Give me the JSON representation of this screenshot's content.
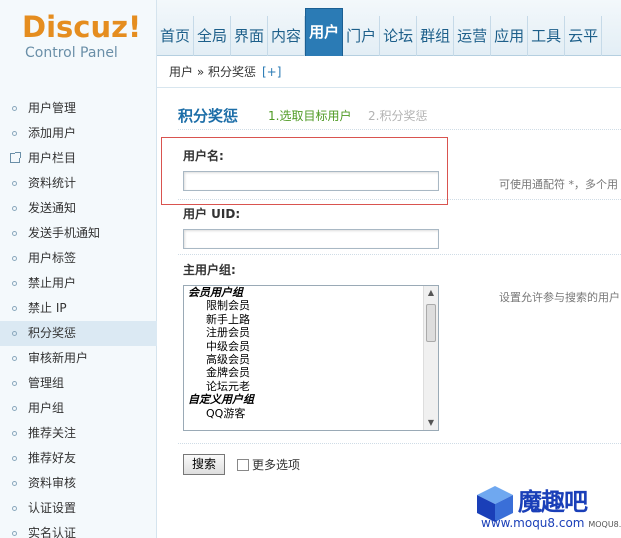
{
  "logo": {
    "main": "Discuz!",
    "sub": "Control Panel"
  },
  "topnav": [
    "首页",
    "全局",
    "界面",
    "内容",
    "用户",
    "门户",
    "论坛",
    "群组",
    "运营",
    "应用",
    "工具",
    "云平"
  ],
  "topnav_active": "用户",
  "breadcrumb": {
    "text": "用户 » 积分奖惩",
    "plus": "[+]"
  },
  "sidebar": {
    "items": [
      {
        "label": "用户管理",
        "icon": "dot-icon"
      },
      {
        "label": "添加用户",
        "icon": "dot-icon"
      },
      {
        "label": "用户栏目",
        "icon": "external-link-icon"
      },
      {
        "label": "资料统计",
        "icon": "dot-icon"
      },
      {
        "label": "发送通知",
        "icon": "dot-icon"
      },
      {
        "label": "发送手机通知",
        "icon": "dot-icon"
      },
      {
        "label": "用户标签",
        "icon": "dot-icon"
      },
      {
        "label": "禁止用户",
        "icon": "dot-icon"
      },
      {
        "label": "禁止 IP",
        "icon": "dot-icon"
      },
      {
        "label": "积分奖惩",
        "icon": "dot-icon",
        "active": true
      },
      {
        "label": "审核新用户",
        "icon": "dot-icon"
      },
      {
        "label": "管理组",
        "icon": "dot-icon"
      },
      {
        "label": "用户组",
        "icon": "dot-icon"
      },
      {
        "label": "推荐关注",
        "icon": "dot-icon"
      },
      {
        "label": "推荐好友",
        "icon": "dot-icon"
      },
      {
        "label": "资料审核",
        "icon": "dot-icon"
      },
      {
        "label": "认证设置",
        "icon": "dot-icon"
      },
      {
        "label": "实名认证",
        "icon": "dot-icon"
      }
    ]
  },
  "tabs": {
    "title": "积分奖惩",
    "step1": "1.选取目标用户",
    "step2": "2.积分奖惩"
  },
  "form": {
    "username_label": "用户名:",
    "username_value": "",
    "username_hint": "可使用通配符 *，多个用",
    "uid_label": "用户 UID:",
    "uid_value": "",
    "group_label": "主用户组:",
    "group_hint": "设置允许参与搜索的用户",
    "group_options": [
      {
        "label": "会员用户组",
        "group": true
      },
      {
        "label": "限制会员"
      },
      {
        "label": "新手上路"
      },
      {
        "label": "注册会员"
      },
      {
        "label": "中级会员"
      },
      {
        "label": "高级会员"
      },
      {
        "label": "金牌会员"
      },
      {
        "label": "论坛元老"
      },
      {
        "label": "自定义用户组",
        "group": true
      },
      {
        "label": "QQ游客"
      }
    ],
    "search_button": "搜索",
    "more_options": "更多选项"
  },
  "watermark": {
    "text": "魔趣吧",
    "url": "www.moqu8.com",
    "small": "MOQU8.COM"
  },
  "colors": {
    "accent": "#2b7bb5",
    "logo": "#e58d1f",
    "step_active": "#4f9a24",
    "highlight_box": "#d9534f"
  }
}
